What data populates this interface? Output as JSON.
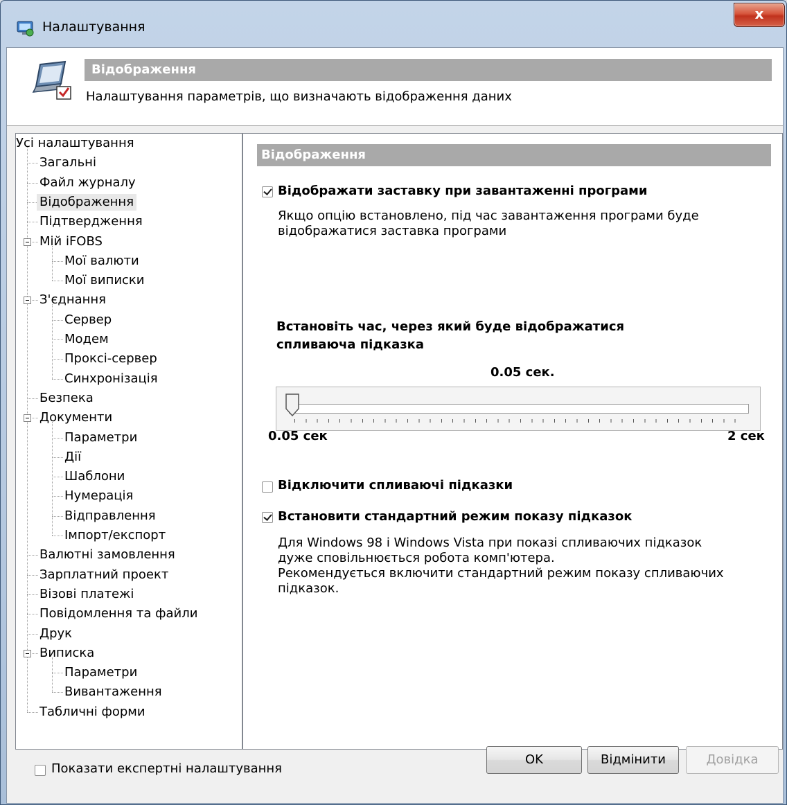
{
  "window": {
    "title": "Налаштування",
    "close_label": "x"
  },
  "header": {
    "title": "Відображення",
    "description": "Налаштування параметрів, що визначають відображення даних"
  },
  "tree": {
    "items": [
      {
        "label": "Усі налаштування",
        "level": 0
      },
      {
        "label": "Загальні",
        "level": 1
      },
      {
        "label": "Файл журналу",
        "level": 1
      },
      {
        "label": "Відображення",
        "level": 1,
        "selected": true
      },
      {
        "label": "Підтвердження",
        "level": 1
      },
      {
        "label": "Мій iFOBS",
        "level": 1,
        "expandable": true
      },
      {
        "label": "Мої валюти",
        "level": 2
      },
      {
        "label": "Мої виписки",
        "level": 2
      },
      {
        "label": "З'єднання",
        "level": 1,
        "expandable": true
      },
      {
        "label": "Сервер",
        "level": 2
      },
      {
        "label": "Модем",
        "level": 2
      },
      {
        "label": "Проксі-сервер",
        "level": 2
      },
      {
        "label": "Синхронізація",
        "level": 2
      },
      {
        "label": "Безпека",
        "level": 1
      },
      {
        "label": "Документи",
        "level": 1,
        "expandable": true
      },
      {
        "label": "Параметри",
        "level": 2
      },
      {
        "label": "Дії",
        "level": 2
      },
      {
        "label": "Шаблони",
        "level": 2
      },
      {
        "label": "Нумерація",
        "level": 2
      },
      {
        "label": "Відправлення",
        "level": 2
      },
      {
        "label": "Імпорт/експорт",
        "level": 2
      },
      {
        "label": "Валютні замовлення",
        "level": 1
      },
      {
        "label": "Зарплатний проект",
        "level": 1
      },
      {
        "label": "Візові платежі",
        "level": 1
      },
      {
        "label": "Повідомлення та файли",
        "level": 1
      },
      {
        "label": "Друк",
        "level": 1
      },
      {
        "label": "Виписка",
        "level": 1,
        "expandable": true
      },
      {
        "label": "Параметри",
        "level": 2
      },
      {
        "label": "Вивантаження",
        "level": 2
      },
      {
        "label": "Табличні форми",
        "level": 1
      }
    ]
  },
  "content": {
    "section_title": "Відображення",
    "splash": {
      "label": "Відображати заставку при завантаженні програми",
      "checked": true,
      "description_line1": "Якщо опцію встановлено, під час завантаження програми буде",
      "description_line2": "відображатися заставка програми"
    },
    "tooltip_delay": {
      "heading_line1": "Встановіть час, через який буде відображатися",
      "heading_line2": "спливаюча підказка",
      "current_value": "0.05 сек.",
      "min_label": "0.05 сек",
      "max_label": "2 сек",
      "value_fraction": 0.0
    },
    "disable_tooltips": {
      "label": "Відключити спливаючі підказки",
      "checked": false
    },
    "standard_mode": {
      "label": "Встановити стандартний режим показу підказок",
      "checked": true,
      "description_line1": "Для Windows 98 і Windows Vista при показі спливаючих підказок",
      "description_line2": "дуже сповільнюється робота комп'ютера.",
      "description_line3": "Рекомендується включити стандартний режим показу спливаючих",
      "description_line4": "підказок."
    }
  },
  "footer": {
    "expert_label": "Показати експертні налаштування",
    "expert_checked": false,
    "ok_label": "OK",
    "cancel_label": "Відмінити",
    "help_label": "Довідка"
  }
}
